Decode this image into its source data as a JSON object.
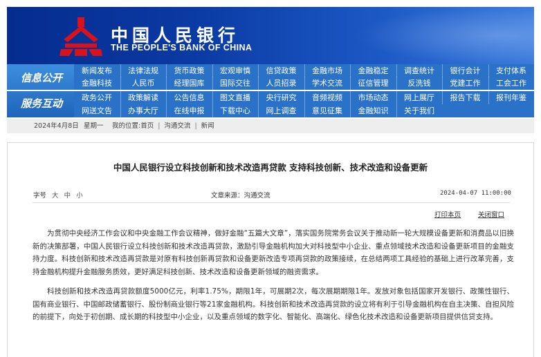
{
  "header": {
    "title_cn": "中国人民银行",
    "title_en": "THE PEOPLE'S BANK OF CHINA",
    "brand_color": "#0a3aa3",
    "emblem_color": "#d9121b"
  },
  "nav": {
    "group1_label": "信息公开",
    "group2_label": "服务互动",
    "rows": [
      [
        "新闻发布",
        "法律法规",
        "货币政策",
        "宏观审慎",
        "信贷政策",
        "金融市场",
        "金融稳定",
        "调查统计",
        "银行会计",
        "支付体系"
      ],
      [
        "金融科技",
        "人民币",
        "经理国库",
        "国际交往",
        "人员招录",
        "学术交流",
        "征信管理",
        "反洗钱",
        "党建工作",
        "工会工作"
      ],
      [
        "政务公开",
        "政策解读",
        "公告信息",
        "图文直播",
        "央行研究",
        "音频视频",
        "市场动态",
        "网上展厅",
        "报告下载",
        "报刊年鉴"
      ],
      [
        "网送文告",
        "办事大厅",
        "在线申报",
        "下载中心",
        "网上调查",
        "意见征集",
        "金融知识",
        "关于我们"
      ]
    ]
  },
  "breadcrumb": {
    "date": "2024年4月8日",
    "weekday": "星期一",
    "position_label": "我的位置:",
    "items": [
      "首页",
      "沟通交流",
      "新闻"
    ]
  },
  "article": {
    "title": "中国人民银行设立科技创新和技术改造再贷款 支持科技创新、技术改造和设备更新",
    "font_size_label": "字号",
    "font_sizes": [
      "大",
      "中",
      "小"
    ],
    "source": "文章来源：沟通交流",
    "publish_time": "2024-04-07 11:00:00",
    "print_label": "打印本页",
    "close_label": "关闭窗口",
    "paragraphs": [
      "为贯彻中央经济工作会议和中央金融工作会议精神，做好金融“五篇大文章”，落实国务院常务会议关于推动新一轮大规模设备更新和消费品以旧换新的决策部署，中国人民银行设立科技创新和技术改造再贷款，激励引导金融机构加大对科技型中小企业、重点领域技术改造和设备更新项目的金融支持力度。科技创新和技术改造再贷款是对原有科技创新再贷款和设备更新改造专项再贷款的政策接续，在总结两项工具经验的基础上进行改革完善，支持金融机构提升金融服务质效，更好满足科技创新、技术改造和设备更新领域的融资需求。",
      "科技创新和技术改造再贷款额度5000亿元，利率1.75%，期限1年，可展期2次，每次展期期限1年。发放对象包括国家开发银行、政策性银行、国有商业银行、中国邮政储蓄银行、股份制商业银行等21家金融机构。科技创新和技术改造再贷款的设立将有利于引导金融机构在自主决策、自担风险的前提下，向处于初创期、成长期的科技型中小企业，以及重点领域的数字化、智能化、高端化、绿色化技术改造和设备更新项目提供信贷支持。"
    ]
  }
}
